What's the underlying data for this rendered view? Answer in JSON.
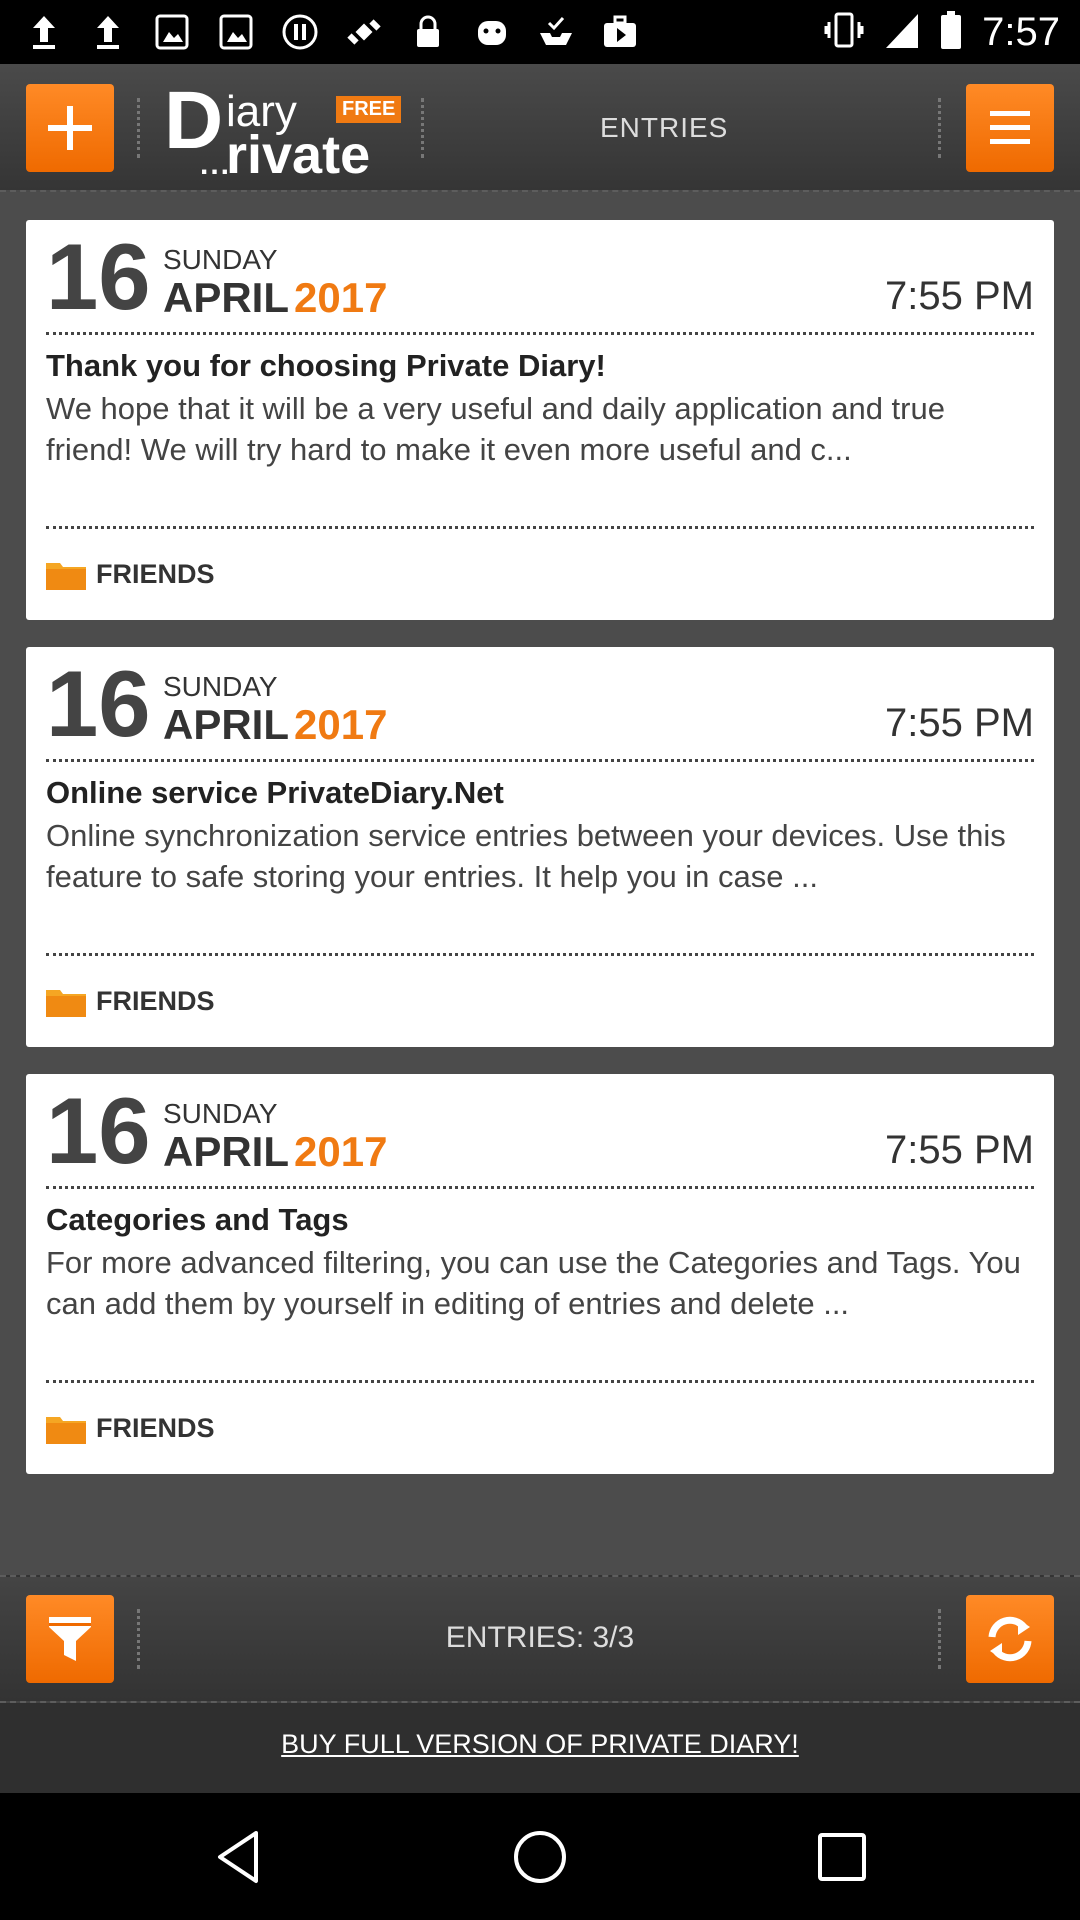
{
  "status_bar": {
    "time": "7:57",
    "left_icons": [
      "upload-arrow-icon",
      "upload-arrow-icon",
      "image-icon",
      "image-icon",
      "pause-icon",
      "satellite-icon",
      "lock-icon",
      "android-icon",
      "inbox-check-icon",
      "briefcase-play-icon"
    ],
    "right_icons": [
      "vibrate-icon",
      "signal-icon",
      "battery-icon"
    ]
  },
  "header": {
    "logo": {
      "d": "D",
      "iary": "iary",
      "free": "FREE",
      "dots": "...",
      "rivate": "rivate"
    },
    "title": "ENTRIES",
    "add_icon": "plus-icon",
    "menu_icon": "menu-icon"
  },
  "entries": [
    {
      "day": "16",
      "weekday": "SUNDAY",
      "month": "APRIL",
      "year": "2017",
      "time": "7:55 PM",
      "title": "Thank you for choosing Private Diary!",
      "body": "We hope that it will be a very useful and daily application and true friend! We will try hard to make it even more useful and c...",
      "category": "FRIENDS"
    },
    {
      "day": "16",
      "weekday": "SUNDAY",
      "month": "APRIL",
      "year": "2017",
      "time": "7:55 PM",
      "title": "Online service PrivateDiary.Net",
      "body": "Online synchronization service entries between your devices. Use this feature to safe storing your entries. It help you in case ...",
      "category": "FRIENDS"
    },
    {
      "day": "16",
      "weekday": "SUNDAY",
      "month": "APRIL",
      "year": "2017",
      "time": "7:55 PM",
      "title": "Categories and Tags",
      "body": "For more advanced filtering, you can use the Categories and Tags. You can add them by yourself in editing of entries and delete ...",
      "category": "FRIENDS"
    }
  ],
  "bottom_bar": {
    "entries_count": "ENTRIES: 3/3",
    "filter_icon": "filter-icon",
    "sync_icon": "sync-icon"
  },
  "buy_link": "BUY FULL VERSION OF PRIVATE DIARY!",
  "nav_bar": {
    "back_icon": "back-icon",
    "home_icon": "home-icon",
    "recents_icon": "recents-icon"
  },
  "colors": {
    "accent": "#f07a12",
    "header_bg": "#3d3d3d",
    "content_bg": "#4c4c4c",
    "card_bg": "#ffffff"
  }
}
